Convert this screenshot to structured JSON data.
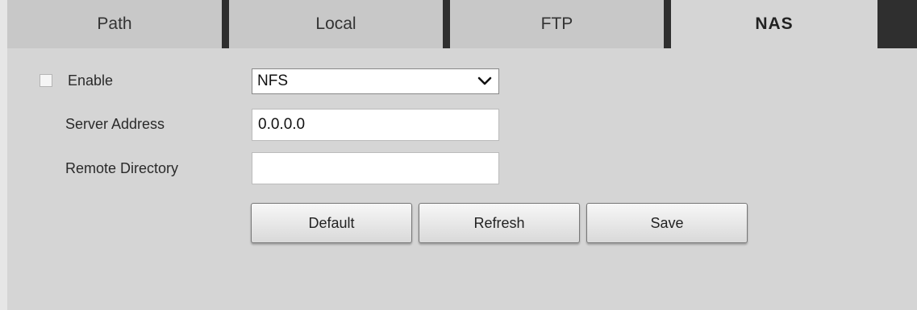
{
  "tabs": [
    {
      "label": "Path",
      "active": false
    },
    {
      "label": "Local",
      "active": false
    },
    {
      "label": "FTP",
      "active": false
    },
    {
      "label": "NAS",
      "active": true
    }
  ],
  "form": {
    "enable_label": "Enable",
    "enable_checked": false,
    "protocol_selected": "NFS",
    "server_address_label": "Server Address",
    "server_address_value": "0.0.0.0",
    "remote_directory_label": "Remote Directory",
    "remote_directory_value": ""
  },
  "buttons": {
    "default": "Default",
    "refresh": "Refresh",
    "save": "Save"
  },
  "colors": {
    "panel_bg": "#d5d5d5",
    "tab_inactive_bg": "#c8c8c8",
    "separator": "#2f2f2f"
  }
}
